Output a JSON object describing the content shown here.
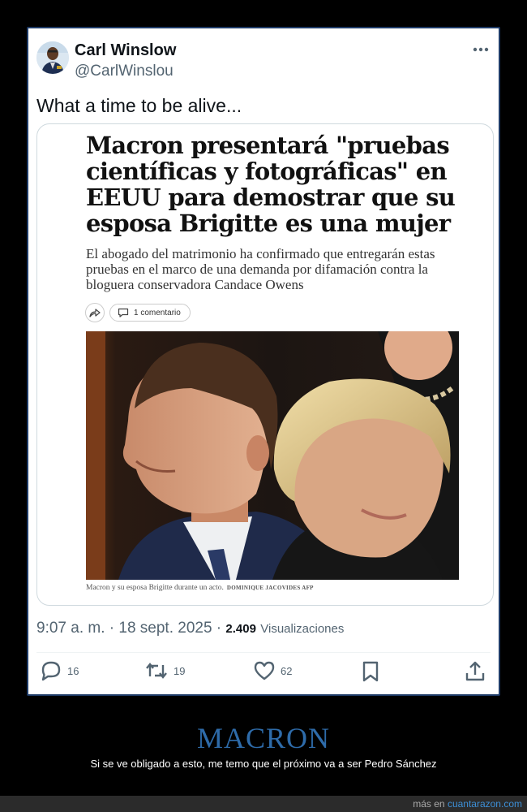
{
  "tweet": {
    "author_name": "Carl Winslow",
    "author_handle": "@CarlWinslou",
    "text": "What a time to be alive...",
    "timestamp": "9:07 a. m. · 18 sept. 2025 ·",
    "views_count": "2.409",
    "views_label": "Visualizaciones",
    "actions": {
      "reply_count": "16",
      "retweet_count": "19",
      "like_count": "62"
    }
  },
  "article": {
    "headline": "Macron presentará \"pruebas científicas y fotográficas\" en EEUU para demostrar que su esposa Brigitte es una mujer",
    "subheadline": "El abogado del matrimonio ha confirmado que entregarán estas pruebas en el marco de una demanda por difamación contra la bloguera conservadora Candace Owens",
    "comment_button": "1 comentario",
    "caption": "Macron y su esposa Brigitte durante un acto.",
    "caption_credit": "DOMINIQUE JACOVIDES AFP"
  },
  "footer": {
    "title": "MACRON",
    "subtitle": "Si se ve obligado a esto, me temo que el próximo va a ser Pedro Sánchez",
    "watermark_prefix": "más en ",
    "watermark_site": "cuantarazon.com"
  },
  "colors": {
    "card_border": "#1d3a66",
    "footer_title": "#2e6ba9",
    "link": "#3d8fd6",
    "text_secondary": "#536471"
  },
  "icons": [
    "more-icon",
    "share-icon",
    "comment-icon",
    "reply-icon",
    "retweet-icon",
    "like-icon",
    "bookmark-icon",
    "share-upload-icon"
  ]
}
